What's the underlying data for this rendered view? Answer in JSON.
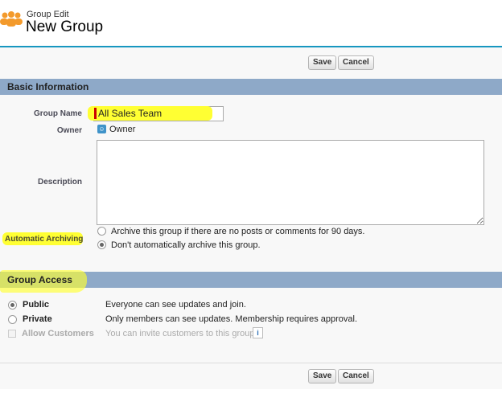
{
  "header": {
    "subtitle": "Group Edit",
    "title": "New Group",
    "icon": "group-icon"
  },
  "toolbar": {
    "save_label": "Save",
    "cancel_label": "Cancel"
  },
  "basic": {
    "title": "Basic Information",
    "group_name_label": "Group Name",
    "group_name_value": "All Sales Team",
    "owner_label": "Owner",
    "owner_value": "Owner",
    "description_label": "Description",
    "description_value": "",
    "archiving_label": "Automatic Archiving",
    "archive_options": [
      "Archive this group if there are no posts or comments for 90 days.",
      "Don't automatically archive this group."
    ],
    "archive_selected": 1
  },
  "access": {
    "title": "Group Access",
    "public_label": "Public",
    "public_desc": "Everyone can see updates and join.",
    "private_label": "Private",
    "private_desc": "Only members can see updates. Membership requires approval.",
    "customers_label": "Allow Customers",
    "customers_desc": "You can invite customers to this group.",
    "selected": "Public"
  },
  "colors": {
    "highlight": "#ffff33",
    "section": "#8ea9c8",
    "accent": "#1797c0"
  }
}
